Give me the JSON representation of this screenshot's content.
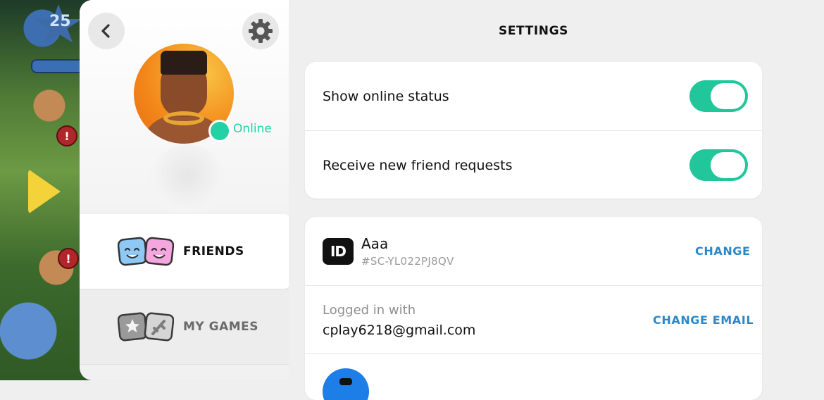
{
  "game_background": {
    "level_number": "25"
  },
  "profile": {
    "status_label": "Online",
    "status_color": "#21d3a4",
    "back_icon": "chevron-left-icon",
    "settings_icon": "gear-icon"
  },
  "nav": {
    "items": [
      {
        "label": "FRIENDS",
        "icon": "friends-faces-icon",
        "active": true
      },
      {
        "label": "MY GAMES",
        "icon": "games-cards-icon",
        "active": false
      }
    ]
  },
  "settings": {
    "title": "SETTINGS",
    "toggles": [
      {
        "label": "Show online status",
        "enabled": true
      },
      {
        "label": "Receive new friend requests",
        "enabled": true
      }
    ],
    "toggle_color": "#21c79b",
    "account": {
      "id_badge": "ID",
      "name": "Aaa",
      "user_id": "#SC-YL022PJ8QV",
      "change_label": "CHANGE",
      "login_caption": "Logged in with",
      "email": "cplay6218@gmail.com",
      "change_email_label": "CHANGE EMAIL"
    },
    "link_color": "#2b88c8"
  }
}
